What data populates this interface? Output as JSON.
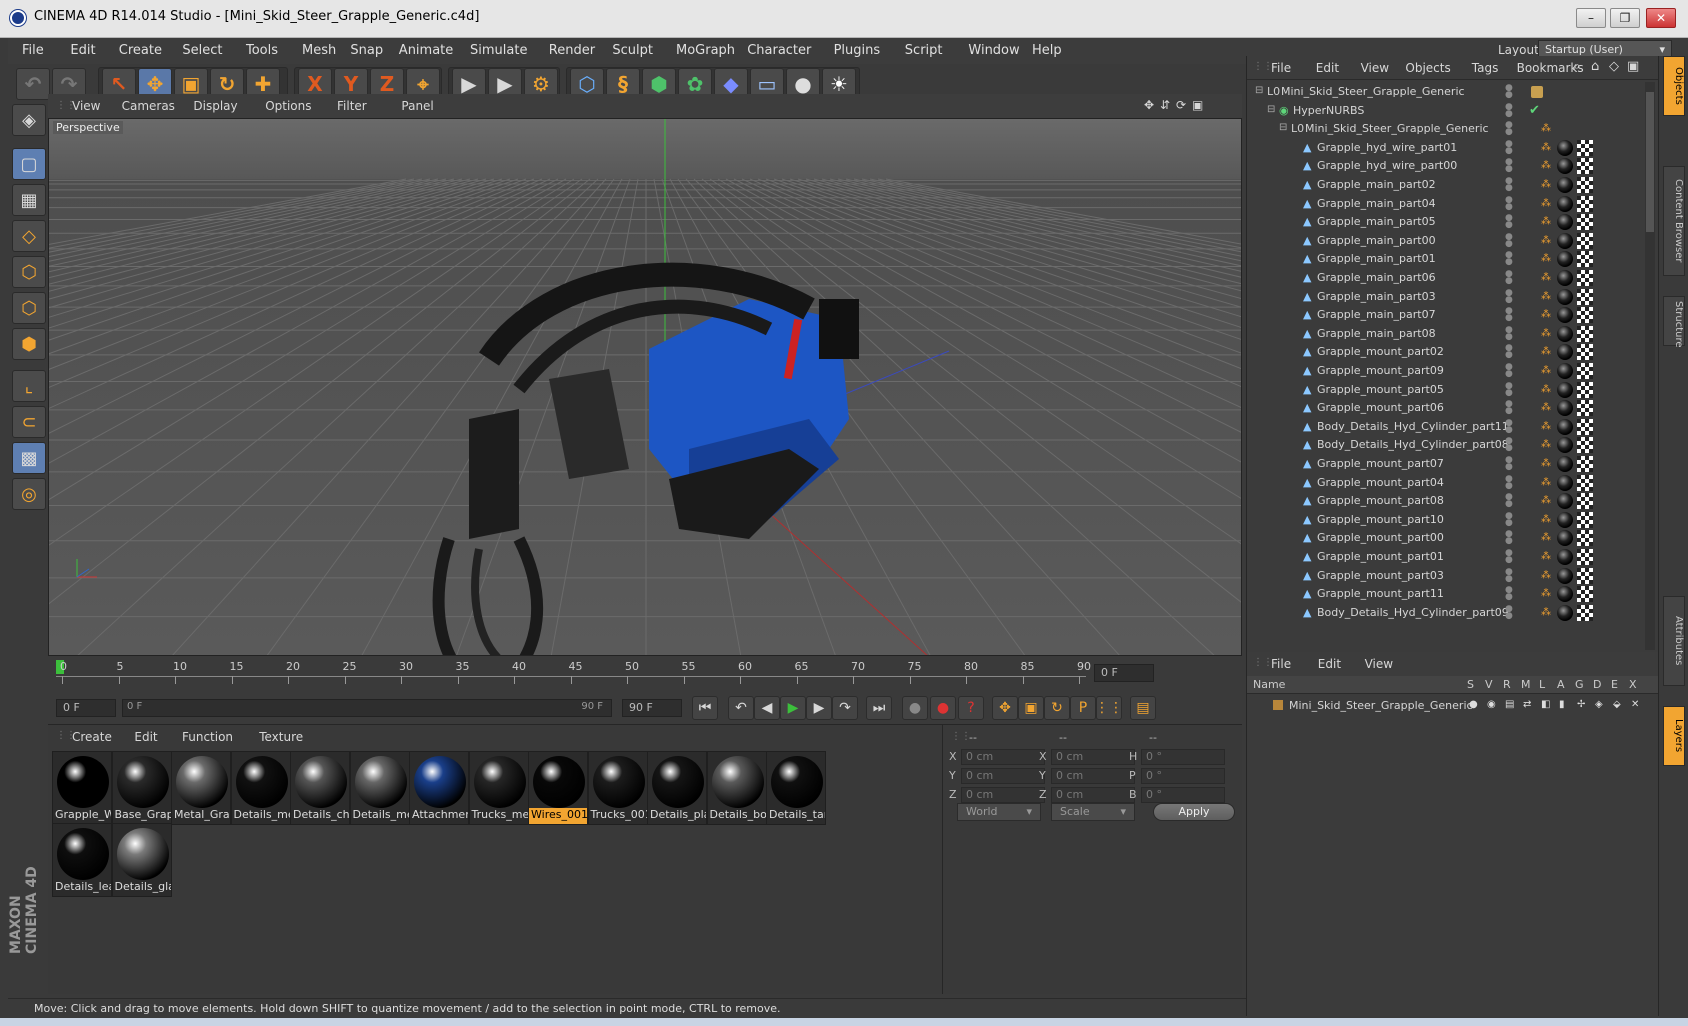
{
  "window": {
    "title": "CINEMA 4D R14.014 Studio - [Mini_Skid_Steer_Grapple_Generic.c4d]",
    "min": "–",
    "max": "❐",
    "close": "✕"
  },
  "menu": [
    "File",
    "Edit",
    "Create",
    "Select",
    "Tools",
    "Mesh",
    "Snap",
    "Animate",
    "Simulate",
    "Render",
    "Sculpt",
    "MoGraph",
    "Character",
    "Plugins",
    "Script",
    "Window",
    "Help"
  ],
  "layout": {
    "label": "Layout:",
    "value": "Startup (User)"
  },
  "toolbar": {
    "undo_icon": "↶",
    "redo_icon": "↷",
    "select_icon": "↖",
    "move_icon": "✥",
    "scale_icon": "▣",
    "rotate_icon": "↻",
    "add_icon": "✚",
    "x_label": "X",
    "y_label": "Y",
    "z_label": "Z",
    "coord_icon": "⌖",
    "render_view_icon": "▶",
    "render_pv_icon": "▶",
    "render_settings_icon": "⚙",
    "cube_icon": "⬡",
    "spline_icon": "§",
    "nurbs_icon": "⬢",
    "array_icon": "✿",
    "deform_icon": "◆",
    "floor_icon": "▭",
    "camera_icon": "●",
    "light_icon": "☀"
  },
  "viewport": {
    "menu": [
      "View",
      "Cameras",
      "Display",
      "Options",
      "Filter",
      "Panel"
    ],
    "label": "Perspective"
  },
  "timeline": {
    "ticks": [
      "0",
      "5",
      "10",
      "15",
      "20",
      "25",
      "30",
      "35",
      "40",
      "45",
      "50",
      "55",
      "60",
      "65",
      "70",
      "75",
      "80",
      "85",
      "90"
    ],
    "current_frame": "0 F",
    "start": "0 F",
    "slider_start": "0 F",
    "slider_end": "90 F",
    "end": "90 F"
  },
  "transport": {
    "first": "⏮",
    "prev_key": "↶",
    "prev": "◀",
    "play": "▶",
    "next": "▶",
    "next_key": "↷",
    "last": "⏭",
    "rec": "●",
    "autokey": "●",
    "help": "?",
    "pos": "✥",
    "scl": "▣",
    "rot": "↻",
    "param": "P",
    "grid": "⋮⋮",
    "timeline": "▤"
  },
  "materials": {
    "menu": [
      "Create",
      "Edit",
      "Function",
      "Texture"
    ],
    "items": [
      {
        "label": "Grapple_W",
        "color": "#000000"
      },
      {
        "label": "Base_Grapp",
        "color": "#2a2a2a"
      },
      {
        "label": "Metal_Grap",
        "color": "#6a6a6a"
      },
      {
        "label": "Details_me",
        "color": "#111111"
      },
      {
        "label": "Details_chr",
        "color": "#555555"
      },
      {
        "label": "Details_me",
        "color": "#666666"
      },
      {
        "label": "Attachmen",
        "color": "#1a3f8a"
      },
      {
        "label": "Trucks_met",
        "color": "#262626"
      },
      {
        "label": "Wires_001",
        "color": "#080808"
      },
      {
        "label": "Trucks_001",
        "color": "#1c1c1c"
      },
      {
        "label": "Details_pla",
        "color": "#151515"
      },
      {
        "label": "Details_bol",
        "color": "#5a5a5a"
      },
      {
        "label": "Details_tan",
        "color": "#101010"
      },
      {
        "label": "Details_lea",
        "color": "#0e0e0e"
      },
      {
        "label": "Details_gla",
        "color": "#7a7a7a"
      }
    ]
  },
  "coords": {
    "headers": [
      "--",
      "--",
      "--"
    ],
    "rows": [
      {
        "l1": "X",
        "v1": "0 cm",
        "l2": "X",
        "v2": "0 cm",
        "l3": "H",
        "v3": "0 °"
      },
      {
        "l1": "Y",
        "v1": "0 cm",
        "l2": "Y",
        "v2": "0 cm",
        "l3": "P",
        "v3": "0 °"
      },
      {
        "l1": "Z",
        "v1": "0 cm",
        "l2": "Z",
        "v2": "0 cm",
        "l3": "B",
        "v3": "0 °"
      }
    ],
    "mode": "World",
    "type": "Scale",
    "apply": "Apply"
  },
  "status": "Move: Click and drag to move elements. Hold down SHIFT to quantize movement / add to the selection in point mode, CTRL to remove.",
  "objects": {
    "menu": [
      "File",
      "Edit",
      "View",
      "Objects",
      "Tags",
      "Bookmarks"
    ],
    "rows": [
      {
        "name": "Mini_Skid_Steer_Grapple_Generic",
        "indent": 0,
        "type": "null"
      },
      {
        "name": "HyperNURBS",
        "indent": 1,
        "type": "nurbs"
      },
      {
        "name": "Mini_Skid_Steer_Grapple_Generic",
        "indent": 2,
        "type": "null"
      },
      {
        "name": "Grapple_hyd_wire_part01",
        "indent": 3,
        "type": "mesh"
      },
      {
        "name": "Grapple_hyd_wire_part00",
        "indent": 3,
        "type": "mesh"
      },
      {
        "name": "Grapple_main_part02",
        "indent": 3,
        "type": "mesh"
      },
      {
        "name": "Grapple_main_part04",
        "indent": 3,
        "type": "mesh"
      },
      {
        "name": "Grapple_main_part05",
        "indent": 3,
        "type": "mesh"
      },
      {
        "name": "Grapple_main_part00",
        "indent": 3,
        "type": "mesh"
      },
      {
        "name": "Grapple_main_part01",
        "indent": 3,
        "type": "mesh"
      },
      {
        "name": "Grapple_main_part06",
        "indent": 3,
        "type": "mesh"
      },
      {
        "name": "Grapple_main_part03",
        "indent": 3,
        "type": "mesh"
      },
      {
        "name": "Grapple_main_part07",
        "indent": 3,
        "type": "mesh"
      },
      {
        "name": "Grapple_main_part08",
        "indent": 3,
        "type": "mesh"
      },
      {
        "name": "Grapple_mount_part02",
        "indent": 3,
        "type": "mesh"
      },
      {
        "name": "Grapple_mount_part09",
        "indent": 3,
        "type": "mesh"
      },
      {
        "name": "Grapple_mount_part05",
        "indent": 3,
        "type": "mesh"
      },
      {
        "name": "Grapple_mount_part06",
        "indent": 3,
        "type": "mesh"
      },
      {
        "name": "Body_Details_Hyd_Cylinder_part11",
        "indent": 3,
        "type": "mesh"
      },
      {
        "name": "Body_Details_Hyd_Cylinder_part08",
        "indent": 3,
        "type": "mesh"
      },
      {
        "name": "Grapple_mount_part07",
        "indent": 3,
        "type": "mesh"
      },
      {
        "name": "Grapple_mount_part04",
        "indent": 3,
        "type": "mesh"
      },
      {
        "name": "Grapple_mount_part08",
        "indent": 3,
        "type": "mesh"
      },
      {
        "name": "Grapple_mount_part10",
        "indent": 3,
        "type": "mesh"
      },
      {
        "name": "Grapple_mount_part00",
        "indent": 3,
        "type": "mesh"
      },
      {
        "name": "Grapple_mount_part01",
        "indent": 3,
        "type": "mesh"
      },
      {
        "name": "Grapple_mount_part03",
        "indent": 3,
        "type": "mesh"
      },
      {
        "name": "Grapple_mount_part11",
        "indent": 3,
        "type": "mesh"
      },
      {
        "name": "Body_Details_Hyd_Cylinder_part09",
        "indent": 3,
        "type": "mesh"
      }
    ]
  },
  "layers": {
    "menu": [
      "File",
      "Edit",
      "View"
    ],
    "columns": [
      "Name",
      "S",
      "V",
      "R",
      "M",
      "L",
      "A",
      "G",
      "D",
      "E",
      "X"
    ],
    "rows": [
      {
        "name": "Mini_Skid_Steer_Grapple_Generic"
      }
    ]
  },
  "right_tabs": [
    "Objects",
    "Content Browser",
    "Structure",
    "Attributes",
    "Layers"
  ],
  "brand": "MAXON CINEMA 4D",
  "colors": {
    "accent": "#f2a531",
    "selected_tool": "#5e7fb2",
    "viewport": "#505050"
  }
}
